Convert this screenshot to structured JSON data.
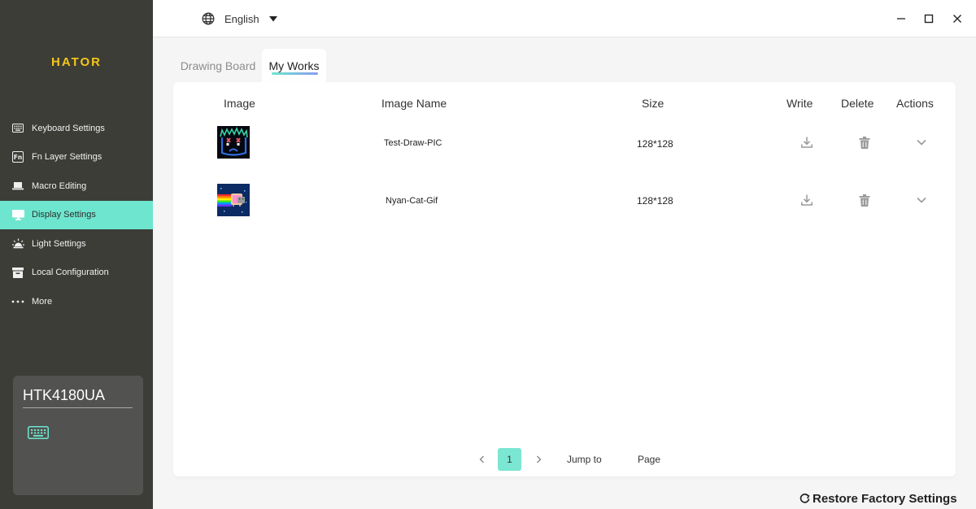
{
  "app": {
    "brand": "HATOR",
    "accent_color": "#6ee6cf",
    "brand_color": "#f4c61a"
  },
  "topbar": {
    "language": "English",
    "language_icon": "globe-icon",
    "window_controls": [
      "minimize-icon",
      "maximize-icon",
      "close-icon"
    ]
  },
  "sidebar": {
    "items": [
      {
        "label": "Keyboard Settings",
        "icon": "keyboard-icon",
        "active": false
      },
      {
        "label": "Fn Layer Settings",
        "icon": "fn-icon",
        "active": false
      },
      {
        "label": "Macro Editing",
        "icon": "laptop-icon",
        "active": false
      },
      {
        "label": "Display Settings",
        "icon": "monitor-icon",
        "active": true
      },
      {
        "label": "Light Settings",
        "icon": "light-icon",
        "active": false
      },
      {
        "label": "Local Configuration",
        "icon": "archive-icon",
        "active": false
      },
      {
        "label": "More",
        "icon": "more-icon",
        "active": false
      }
    ],
    "device": {
      "name": "HTK4180UA",
      "icon": "keyboard-icon"
    }
  },
  "tabs": [
    {
      "label": "Drawing Board",
      "active": false
    },
    {
      "label": "My Works",
      "active": true
    }
  ],
  "table": {
    "headers": {
      "image": "Image",
      "name": "Image Name",
      "size": "Size",
      "write": "Write",
      "delete": "Delete",
      "actions": "Actions"
    },
    "rows": [
      {
        "name": "Test-Draw-PIC",
        "size": "128*128",
        "thumb": "face-drawing"
      },
      {
        "name": "Nyan-Cat-Gif",
        "size": "128*128",
        "thumb": "nyan-cat"
      }
    ]
  },
  "pagination": {
    "current_page": "1",
    "jump_to": "Jump to",
    "page": "Page"
  },
  "footer": {
    "restore": "Restore Factory Settings"
  }
}
